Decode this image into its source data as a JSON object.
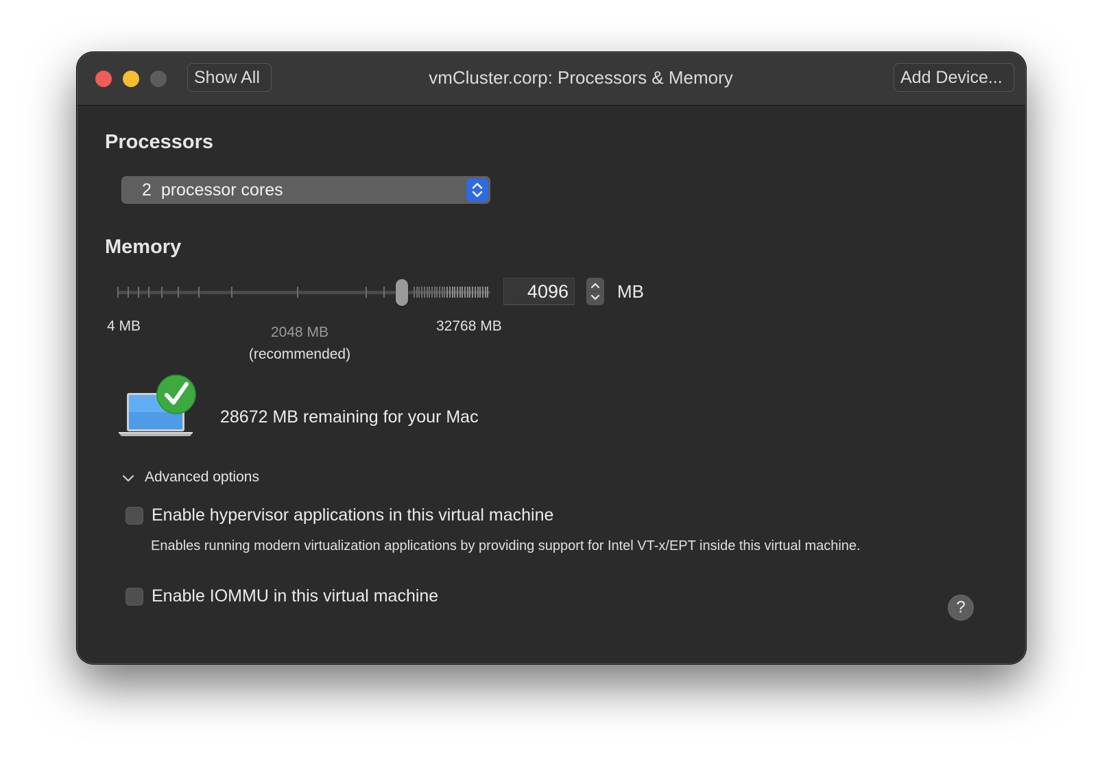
{
  "window": {
    "title": "vmCluster.corp: Processors & Memory",
    "show_all_label": "Show All",
    "add_device_label": "Add Device..."
  },
  "processors": {
    "heading": "Processors",
    "selected_count": "2",
    "selected_unit": "processor cores"
  },
  "memory": {
    "heading": "Memory",
    "value": "4096",
    "unit": "MB",
    "slider": {
      "min_label": "4 MB",
      "max_label": "32768 MB",
      "recommended_value": "2048 MB",
      "recommended_note": "(recommended)",
      "current_mb": 4096
    },
    "remaining_text": "28672 MB remaining for your Mac"
  },
  "advanced": {
    "label": "Advanced options",
    "hypervisor": {
      "label": "Enable hypervisor applications in this virtual machine",
      "checked": false,
      "description": "Enables running modern virtualization applications by providing support for Intel VT-x/EPT inside this virtual machine."
    },
    "iommu": {
      "label": "Enable IOMMU in this virtual machine",
      "checked": false
    }
  },
  "help_glyph": "?",
  "icons": {
    "close": "close-icon",
    "minimize": "minimize-icon",
    "zoom": "zoom-icon",
    "laptop": "laptop-icon",
    "check": "checkmark-icon",
    "disclosure": "chevron-down-icon",
    "help": "help-icon"
  },
  "colors": {
    "close": "#ee5d57",
    "minimize": "#f5bd32",
    "zoom": "#5c5c5c",
    "accent": "#2f6ae0",
    "success": "#3daa3f"
  }
}
